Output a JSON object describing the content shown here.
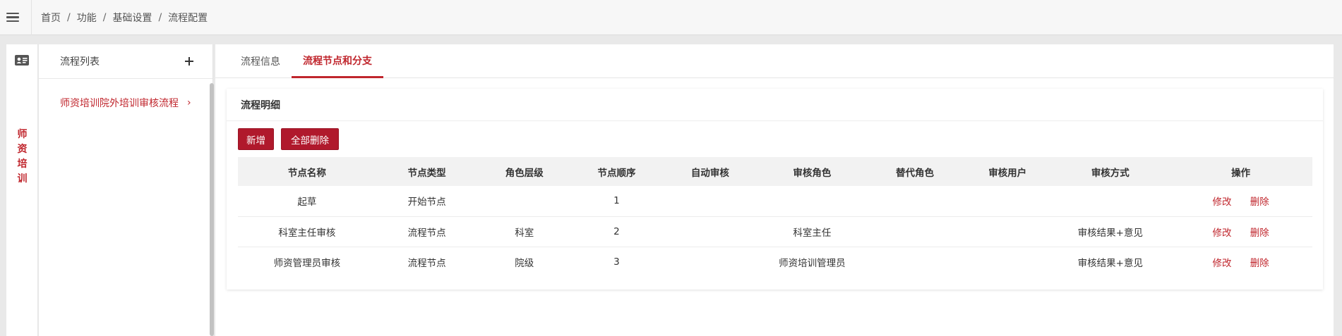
{
  "breadcrumb": [
    "首页",
    "功能",
    "基础设置",
    "流程配置"
  ],
  "breadcrumb_sep": "/",
  "sidebar": {
    "vertical_tab_chars": [
      "师",
      "资",
      "培",
      "训"
    ]
  },
  "list_panel": {
    "title": "流程列表",
    "items": [
      {
        "label": "师资培训院外培训审核流程",
        "chevron": "›"
      }
    ]
  },
  "tabs": [
    {
      "label": "流程信息",
      "active": false
    },
    {
      "label": "流程节点和分支",
      "active": true
    }
  ],
  "detail": {
    "title": "流程明细",
    "buttons": {
      "add": "新增",
      "delete_all": "全部删除"
    },
    "columns": [
      "节点名称",
      "节点类型",
      "角色层级",
      "节点顺序",
      "自动审核",
      "审核角色",
      "替代角色",
      "审核用户",
      "审核方式",
      "操作"
    ],
    "rows": [
      {
        "name": "起草",
        "type": "开始节点",
        "level": "",
        "order": "1",
        "auto": "",
        "role": "",
        "alt_role": "",
        "user": "",
        "method": "",
        "edit": "修改",
        "del": "删除"
      },
      {
        "name": "科室主任审核",
        "type": "流程节点",
        "level": "科室",
        "order": "2",
        "auto": "",
        "role": "科室主任",
        "alt_role": "",
        "user": "",
        "method": "审核结果+意见",
        "edit": "修改",
        "del": "删除"
      },
      {
        "name": "师资管理员审核",
        "type": "流程节点",
        "level": "院级",
        "order": "3",
        "auto": "",
        "role": "师资培训管理员",
        "alt_role": "",
        "user": "",
        "method": "审核结果+意见",
        "edit": "修改",
        "del": "删除"
      }
    ]
  },
  "colors": {
    "accent": "#c0262d",
    "button": "#b0192c"
  }
}
